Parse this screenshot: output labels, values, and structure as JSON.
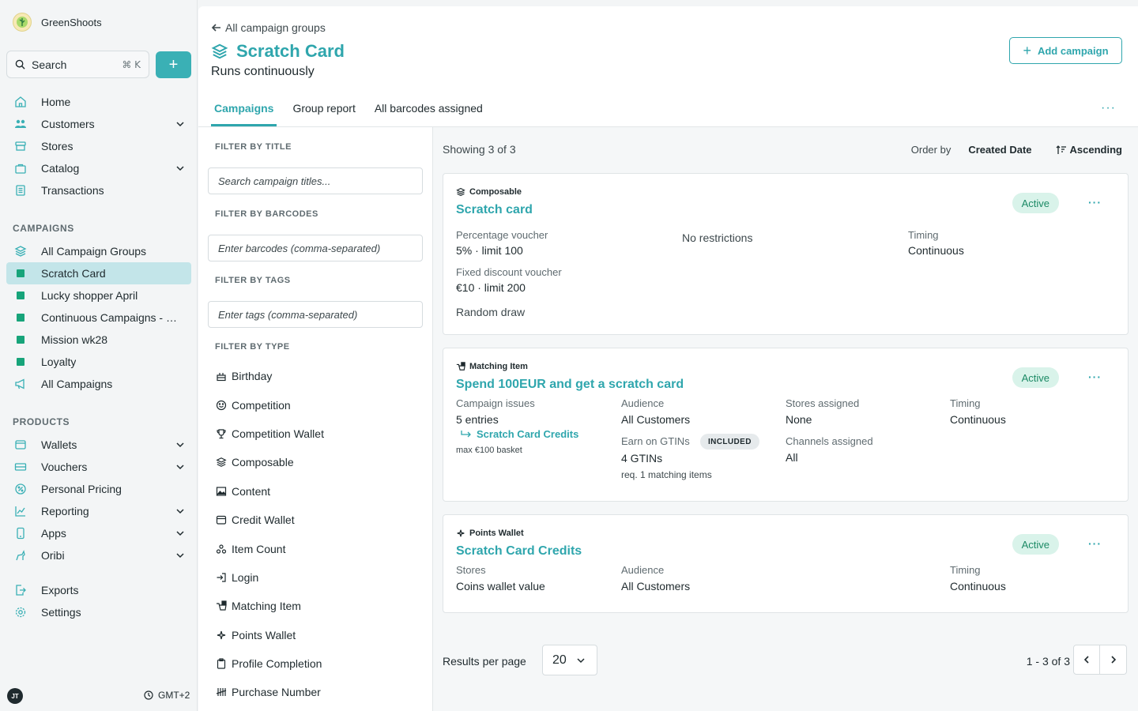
{
  "app": {
    "name": "GreenShoots"
  },
  "sidebar": {
    "search_label": "Search",
    "search_shortcut": "⌘ K",
    "plus_label": "+",
    "main_items": [
      {
        "label": "Home",
        "icon": "home-icon"
      },
      {
        "label": "Customers",
        "icon": "users-icon",
        "expandable": true
      },
      {
        "label": "Stores",
        "icon": "store-icon"
      },
      {
        "label": "Catalog",
        "icon": "bag-icon",
        "expandable": true
      },
      {
        "label": "Transactions",
        "icon": "receipt-icon"
      }
    ],
    "campaigns_title": "CAMPAIGNS",
    "campaign_items": [
      {
        "label": "All Campaign Groups",
        "icon": "layers-icon"
      },
      {
        "label": "Scratch Card",
        "active": true
      },
      {
        "label": "Lucky shopper April"
      },
      {
        "label": "Continuous Campaigns - …"
      },
      {
        "label": "Mission wk28"
      },
      {
        "label": "Loyalty"
      },
      {
        "label": "All Campaigns",
        "icon": "megaphone-icon"
      }
    ],
    "products_title": "PRODUCTS",
    "product_items": [
      {
        "label": "Wallets",
        "expandable": true
      },
      {
        "label": "Vouchers",
        "expandable": true
      },
      {
        "label": "Personal Pricing"
      },
      {
        "label": "Reporting",
        "expandable": true
      },
      {
        "label": "Apps",
        "expandable": true
      },
      {
        "label": "Oribi",
        "expandable": true
      }
    ],
    "bottom_items": [
      {
        "label": "Exports"
      },
      {
        "label": "Settings"
      }
    ],
    "avatar_initials": "JT",
    "timezone": "GMT+2"
  },
  "header": {
    "back_label": "All campaign groups",
    "title": "Scratch Card",
    "subtitle": "Runs continuously",
    "add_button": "Add campaign",
    "tabs": [
      "Campaigns",
      "Group report",
      "All barcodes assigned"
    ],
    "more": "···"
  },
  "filters": {
    "title_label": "FILTER BY TITLE",
    "title_placeholder": "Search campaign titles...",
    "barcode_label": "FILTER BY BARCODES",
    "barcode_placeholder": "Enter barcodes (comma-separated)",
    "tags_label": "FILTER BY TAGS",
    "tags_placeholder": "Enter tags (comma-separated)",
    "type_label": "FILTER BY TYPE",
    "types": [
      "Birthday",
      "Competition",
      "Competition Wallet",
      "Composable",
      "Content",
      "Credit Wallet",
      "Item Count",
      "Login",
      "Matching Item",
      "Points Wallet",
      "Profile Completion",
      "Purchase Number"
    ]
  },
  "results": {
    "showing": "Showing 3 of 3",
    "order_label": "Order by",
    "order_value": "Created Date",
    "order_direction": "Ascending",
    "cards": [
      {
        "type": "Composable",
        "title": "Scratch card",
        "status": "Active",
        "lbl1": "Percentage voucher",
        "val1": "5% · limit 100",
        "lbl2": "Fixed discount voucher",
        "val2": "€10 · limit 200",
        "val3": "Random draw",
        "restrictions": "No restrictions",
        "timing_label": "Timing",
        "timing_value": "Continuous"
      },
      {
        "type": "Matching Item",
        "title": "Spend 100EUR and get a scratch card",
        "status": "Active",
        "issues_label": "Campaign issues",
        "issues_value": "5 entries",
        "issues_link": "Scratch Card Credits",
        "issues_note": "max €100 basket",
        "audience_label": "Audience",
        "audience_value": "All Customers",
        "gtin_label": "Earn on GTINs",
        "gtin_pill": "INCLUDED",
        "gtin_value": "4 GTINs",
        "gtin_note": "req. 1 matching items",
        "stores_label": "Stores assigned",
        "stores_value": "None",
        "channels_label": "Channels assigned",
        "channels_value": "All",
        "timing_label": "Timing",
        "timing_value": "Continuous"
      },
      {
        "type": "Points Wallet",
        "title": "Scratch Card Credits",
        "status": "Active",
        "stores_label": "Stores",
        "stores_value": "Coins wallet value",
        "audience_label": "Audience",
        "audience_value": "All Customers",
        "timing_label": "Timing",
        "timing_value": "Continuous"
      }
    ],
    "per_page_label": "Results per page",
    "per_page_value": "20",
    "pager_text": "1 - 3 of 3"
  },
  "colors": {
    "accent": "#2fa6ad",
    "active_nav": "#c3e5e9",
    "status_bg": "#d9f3ea",
    "group_square": "#17a47a"
  }
}
